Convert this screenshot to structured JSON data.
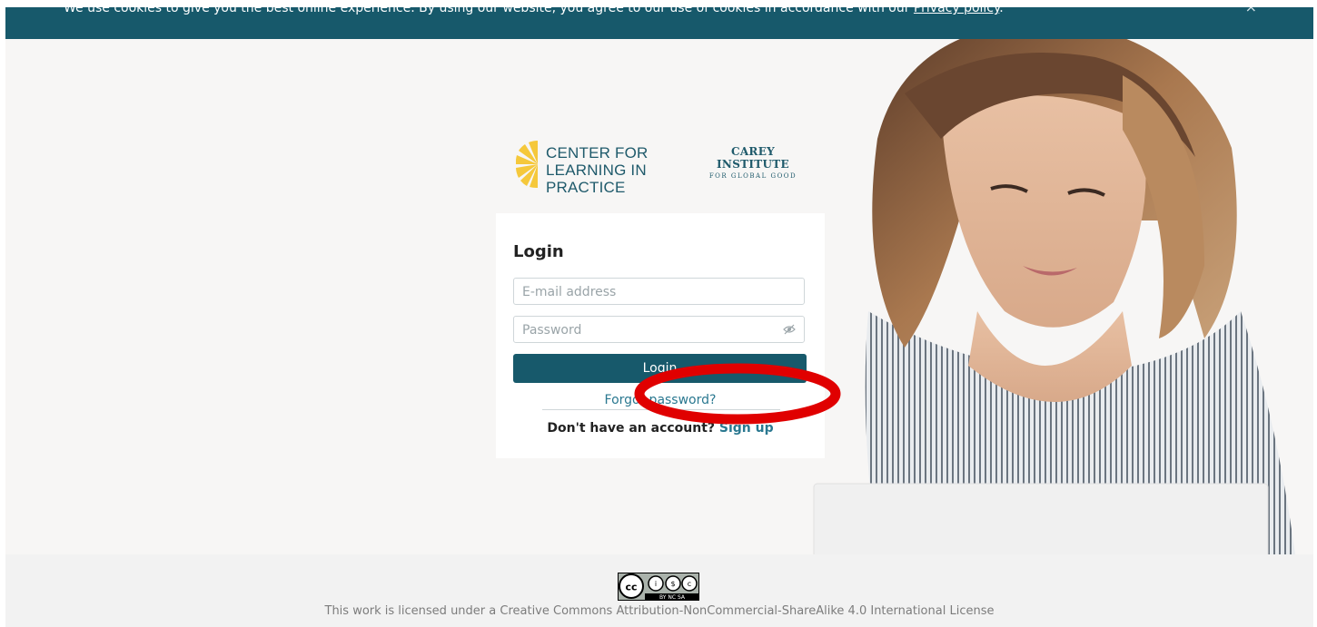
{
  "cookie_banner": {
    "text": "We use cookies to give you the best online experience. By using our website, you agree to our use of cookies in accordance with our ",
    "privacy_link": "Privacy policy",
    "suffix": ".",
    "close_symbol": "×"
  },
  "logos": {
    "clip_line1": "CENTER FOR",
    "clip_line2": "LEARNING IN PRACTICE",
    "carey_line1": "CAREY INSTITUTE",
    "carey_line2": "FOR GLOBAL GOOD"
  },
  "login": {
    "title": "Login",
    "email_placeholder": "E-mail address",
    "password_placeholder": "Password",
    "button_label": "Login",
    "forgot_label": "Forgot password?",
    "no_account_text": "Don't have an account? ",
    "signup_label": "Sign up"
  },
  "footer": {
    "license_text": "This work is licensed under a Creative Commons Attribution-NonCommercial-ShareAlike 4.0 International License",
    "badge_text": "BY NC SA"
  },
  "colors": {
    "brand": "#17596b",
    "link": "#2a7890",
    "annotation": "#e00000",
    "sun": "#f5c83b"
  },
  "icons": [
    "close-icon",
    "eye-slash-icon",
    "sun-logo-icon",
    "creative-commons-icon"
  ]
}
